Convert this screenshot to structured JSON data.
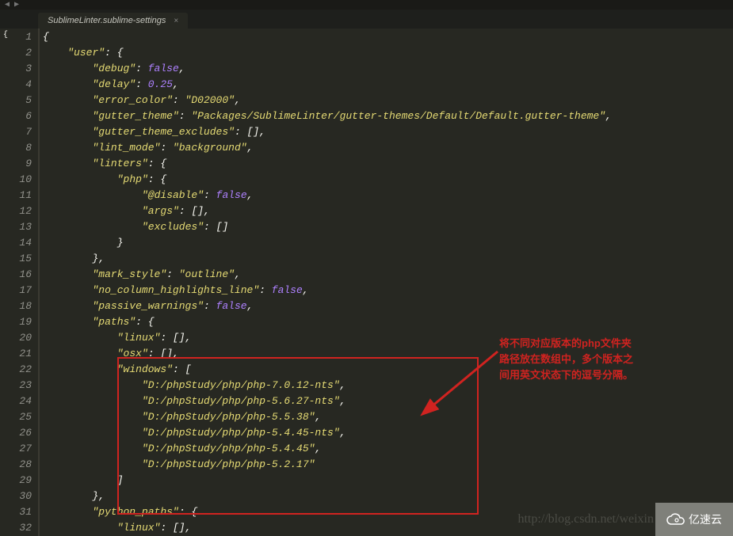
{
  "tab": {
    "title": "SublimeLinter.sublime-settings",
    "close": "×"
  },
  "sidebar_brace": "{",
  "lines": [
    "{",
    "    \"user\": {",
    "        \"debug\": false,",
    "        \"delay\": 0.25,",
    "        \"error_color\": \"D02000\",",
    "        \"gutter_theme\": \"Packages/SublimeLinter/gutter-themes/Default/Default.gutter-theme\",",
    "        \"gutter_theme_excludes\": [],",
    "        \"lint_mode\": \"background\",",
    "        \"linters\": {",
    "            \"php\": {",
    "                \"@disable\": false,",
    "                \"args\": [],",
    "                \"excludes\": []",
    "            }",
    "        },",
    "        \"mark_style\": \"outline\",",
    "        \"no_column_highlights_line\": false,",
    "        \"passive_warnings\": false,",
    "        \"paths\": {",
    "            \"linux\": [],",
    "            \"osx\": [],",
    "            \"windows\": [",
    "                \"D:/phpStudy/php/php-7.0.12-nts\",",
    "                \"D:/phpStudy/php/php-5.6.27-nts\",",
    "                \"D:/phpStudy/php/php-5.5.38\",",
    "                \"D:/phpStudy/php/php-5.4.45-nts\",",
    "                \"D:/phpStudy/php/php-5.4.45\",",
    "                \"D:/phpStudy/php/php-5.2.17\"",
    "            ]",
    "        },",
    "        \"python_paths\": {",
    "            \"linux\": [],"
  ],
  "callout": {
    "l1": "将不同对应版本的php文件夹",
    "l2": "路径放在数组中，多个版本之",
    "l3": "间用英文状态下的逗号分隔。"
  },
  "watermark": "http://blog.csdn.net/weixin",
  "logo_text": "亿速云"
}
